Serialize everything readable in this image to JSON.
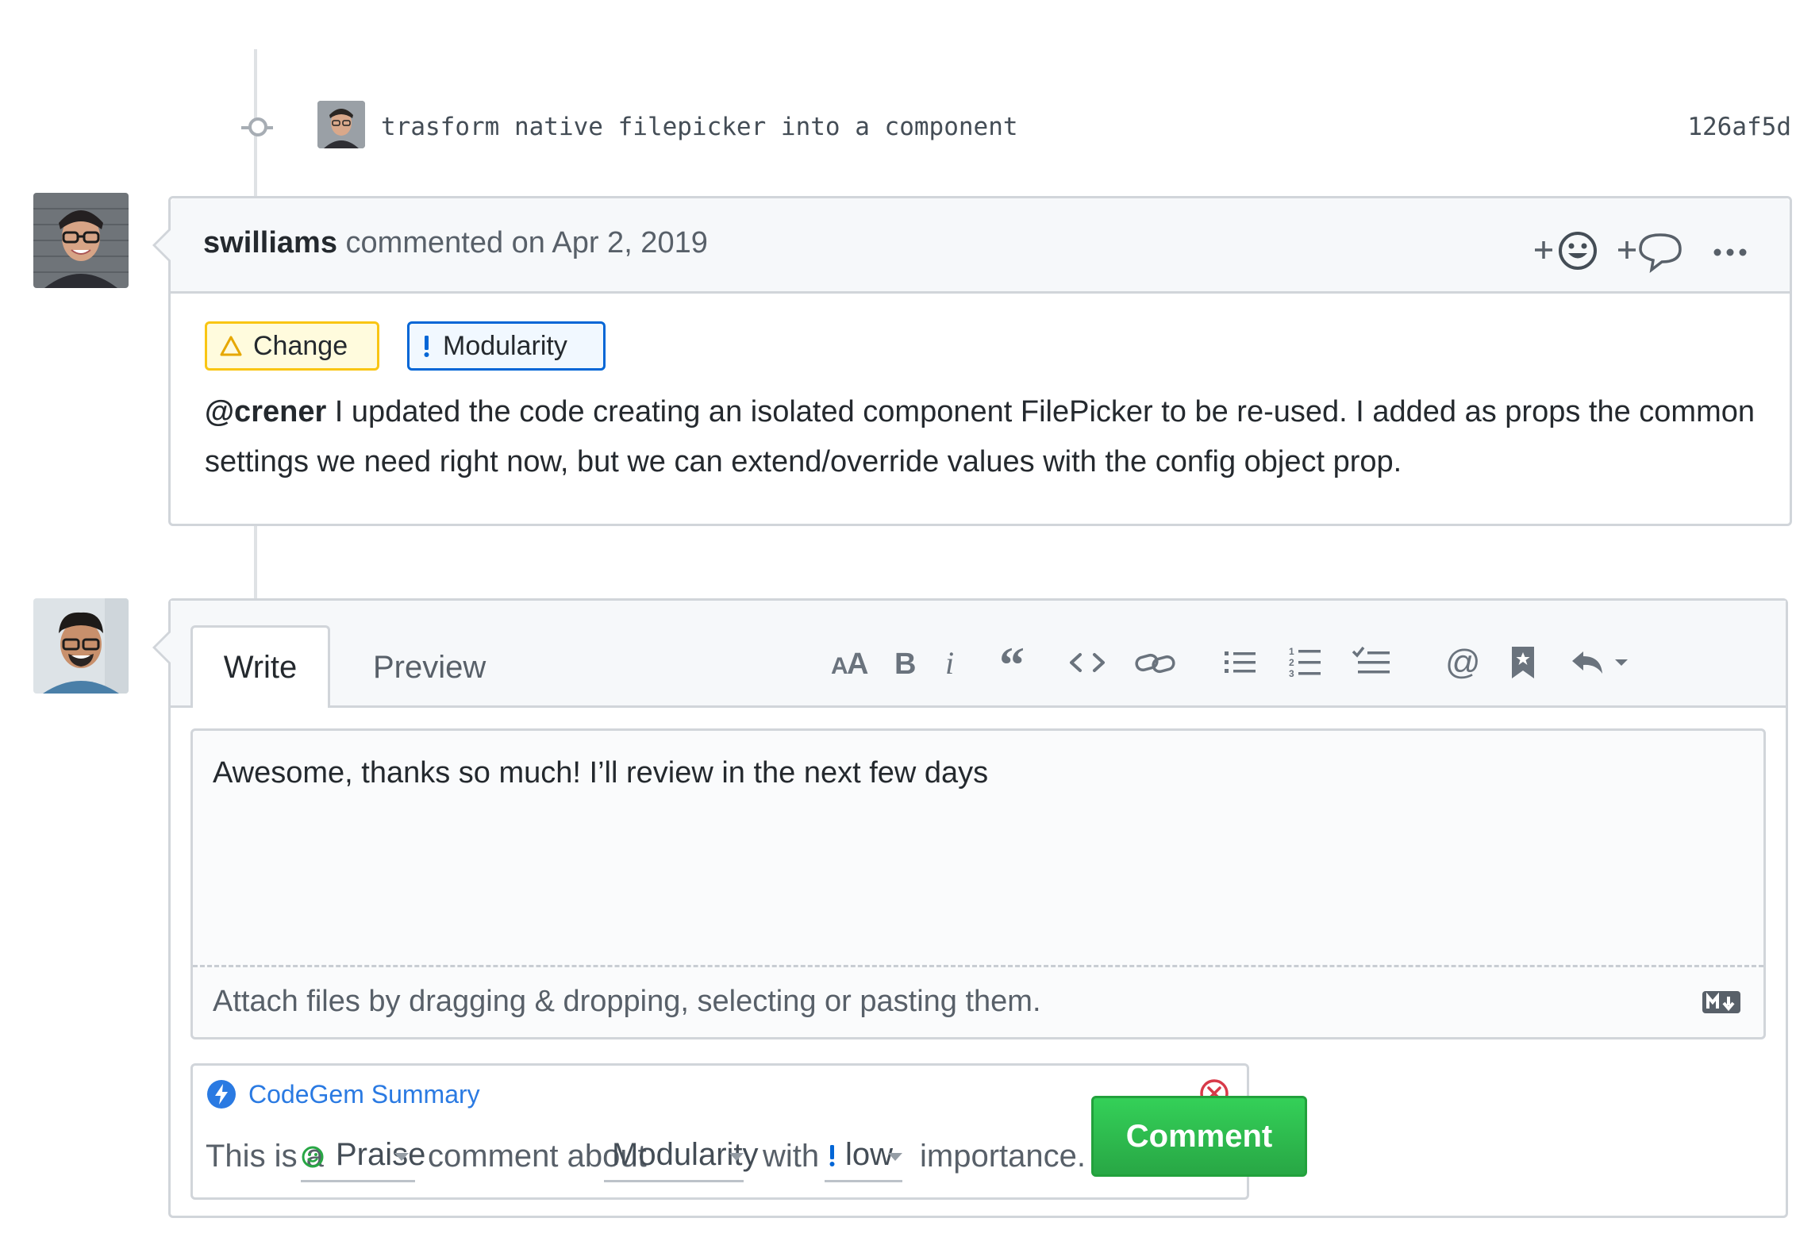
{
  "commit": {
    "message": "trasform native filepicker into a component",
    "sha": "126af5d"
  },
  "comment": {
    "author": "swilliams",
    "meta": "commented on Apr 2, 2019",
    "tags": [
      {
        "icon": "warning-triangle-icon",
        "label": "Change",
        "color": "#f9c513"
      },
      {
        "icon": "exclamation-icon",
        "label": "Modularity",
        "color": "#0366d6"
      }
    ],
    "mention": "@crener",
    "body": " I updated the code creating an isolated component FilePicker to be re-used. I added as props the common settings we need right now, but we can extend/override values with the config object prop."
  },
  "editor": {
    "tabs": {
      "write": "Write",
      "preview": "Preview"
    },
    "text": "Awesome, thanks so much! I’ll review in the next few days",
    "attach_hint": "Attach files by dragging & dropping, selecting or pasting them.",
    "submit_label": "Comment"
  },
  "summary": {
    "title": "CodeGem Summary",
    "prefix": "This is a",
    "type_value": "Praise",
    "mid1": "comment about",
    "topic_value": "Modularity",
    "mid2": "with",
    "importance_value": "low",
    "suffix": "importance."
  },
  "colors": {
    "accent_blue": "#2a7ae2",
    "primary_green": "#2ea44f",
    "warning_yellow": "#f9c513",
    "danger_red": "#d73a49"
  }
}
